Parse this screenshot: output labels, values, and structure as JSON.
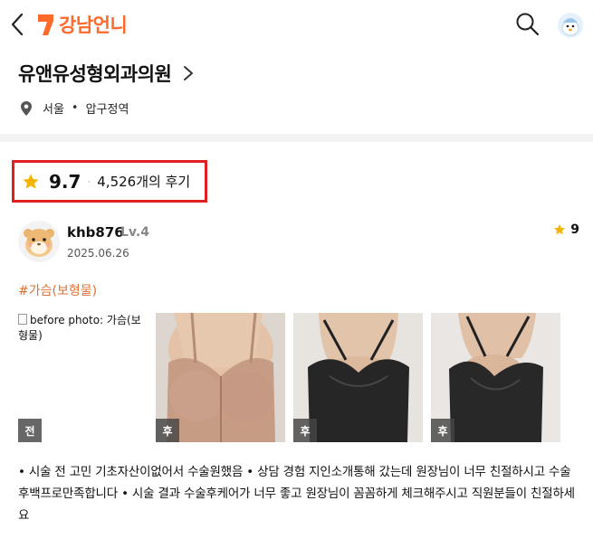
{
  "header": {
    "brand_text": "강남언니",
    "icons": {
      "back": "back-arrow-icon",
      "brand": "brand-logo-icon",
      "search": "search-icon",
      "profile": "profile-avatar-icon"
    }
  },
  "hospital": {
    "name": "유앤유성형외과의원",
    "city": "서울",
    "district": "압구정역",
    "separator": "•"
  },
  "rating": {
    "score": "9.7",
    "separator": "·",
    "review_count": "4,526개의 후기"
  },
  "review": {
    "username": "khb876",
    "level": "Lv.4",
    "date": "2025.06.26",
    "rating": "9",
    "tag": "#가슴(보형물)",
    "photos": [
      {
        "badge": "전",
        "alt": "before photo: 가슴(보형물)",
        "kind": "before"
      },
      {
        "badge": "후",
        "kind": "after",
        "garment": "#c9a08a"
      },
      {
        "badge": "후",
        "kind": "after",
        "garment": "#222222"
      },
      {
        "badge": "후",
        "kind": "after",
        "garment": "#222222"
      }
    ],
    "text": "• 시술 전 고민 기초자산이없어서 수술원했음 • 상담 경험 지인소개통해 갔는데 원장님이 너무 친절하시고 수술후백프로만족합니다 • 시술 결과 수술후케어가 너무 좋고 원장님이 꼼꼼하게 체크해주시고 직원분들이 친절하세요"
  },
  "colors": {
    "brand": "#ff6a2b",
    "highlight_border": "#e02020",
    "star": "#f5b400",
    "tag": "#e07030"
  }
}
